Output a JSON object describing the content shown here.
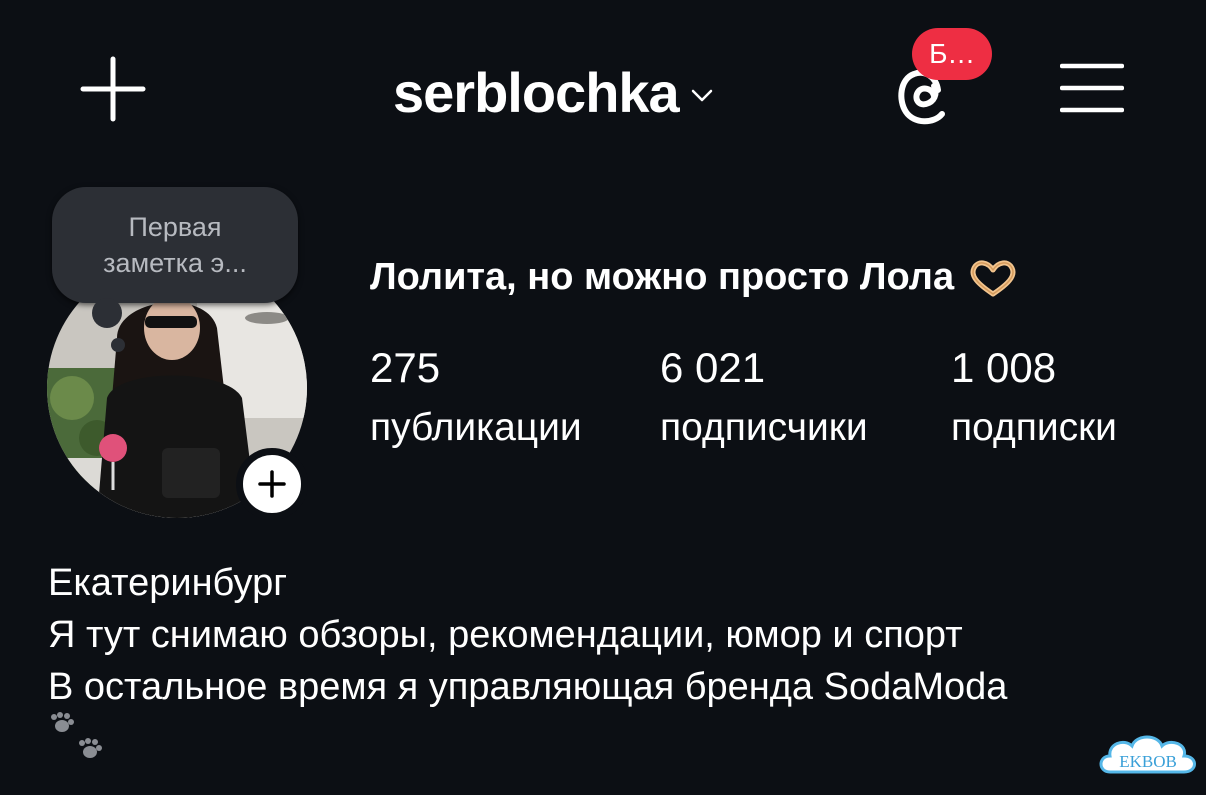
{
  "header": {
    "username": "serblochka",
    "threads_badge": "Б..."
  },
  "note": {
    "line1": "Первая",
    "line2": "заметка э..."
  },
  "profile": {
    "full_name": "Лолита, но можно просто Лола",
    "stats": [
      {
        "value": "275",
        "label": "публикации"
      },
      {
        "value": "6 021",
        "label": "подписчики"
      },
      {
        "value": "1 008",
        "label": "подписки"
      }
    ]
  },
  "bio": {
    "lines": [
      "Екатеринбург",
      "Я тут снимаю обзоры, рекомендации, юмор и спорт",
      "В остальное время я управляющая бренда SodaModa"
    ]
  },
  "watermark": "EKBOB",
  "colors": {
    "background": "#0c0f14",
    "badge": "#ee2e43",
    "note_bubble": "#2c2f35"
  },
  "icons": [
    "plus-icon",
    "chevron-down-icon",
    "threads-icon",
    "menu-icon",
    "heart-hands-icon",
    "paw-prints-icon"
  ]
}
